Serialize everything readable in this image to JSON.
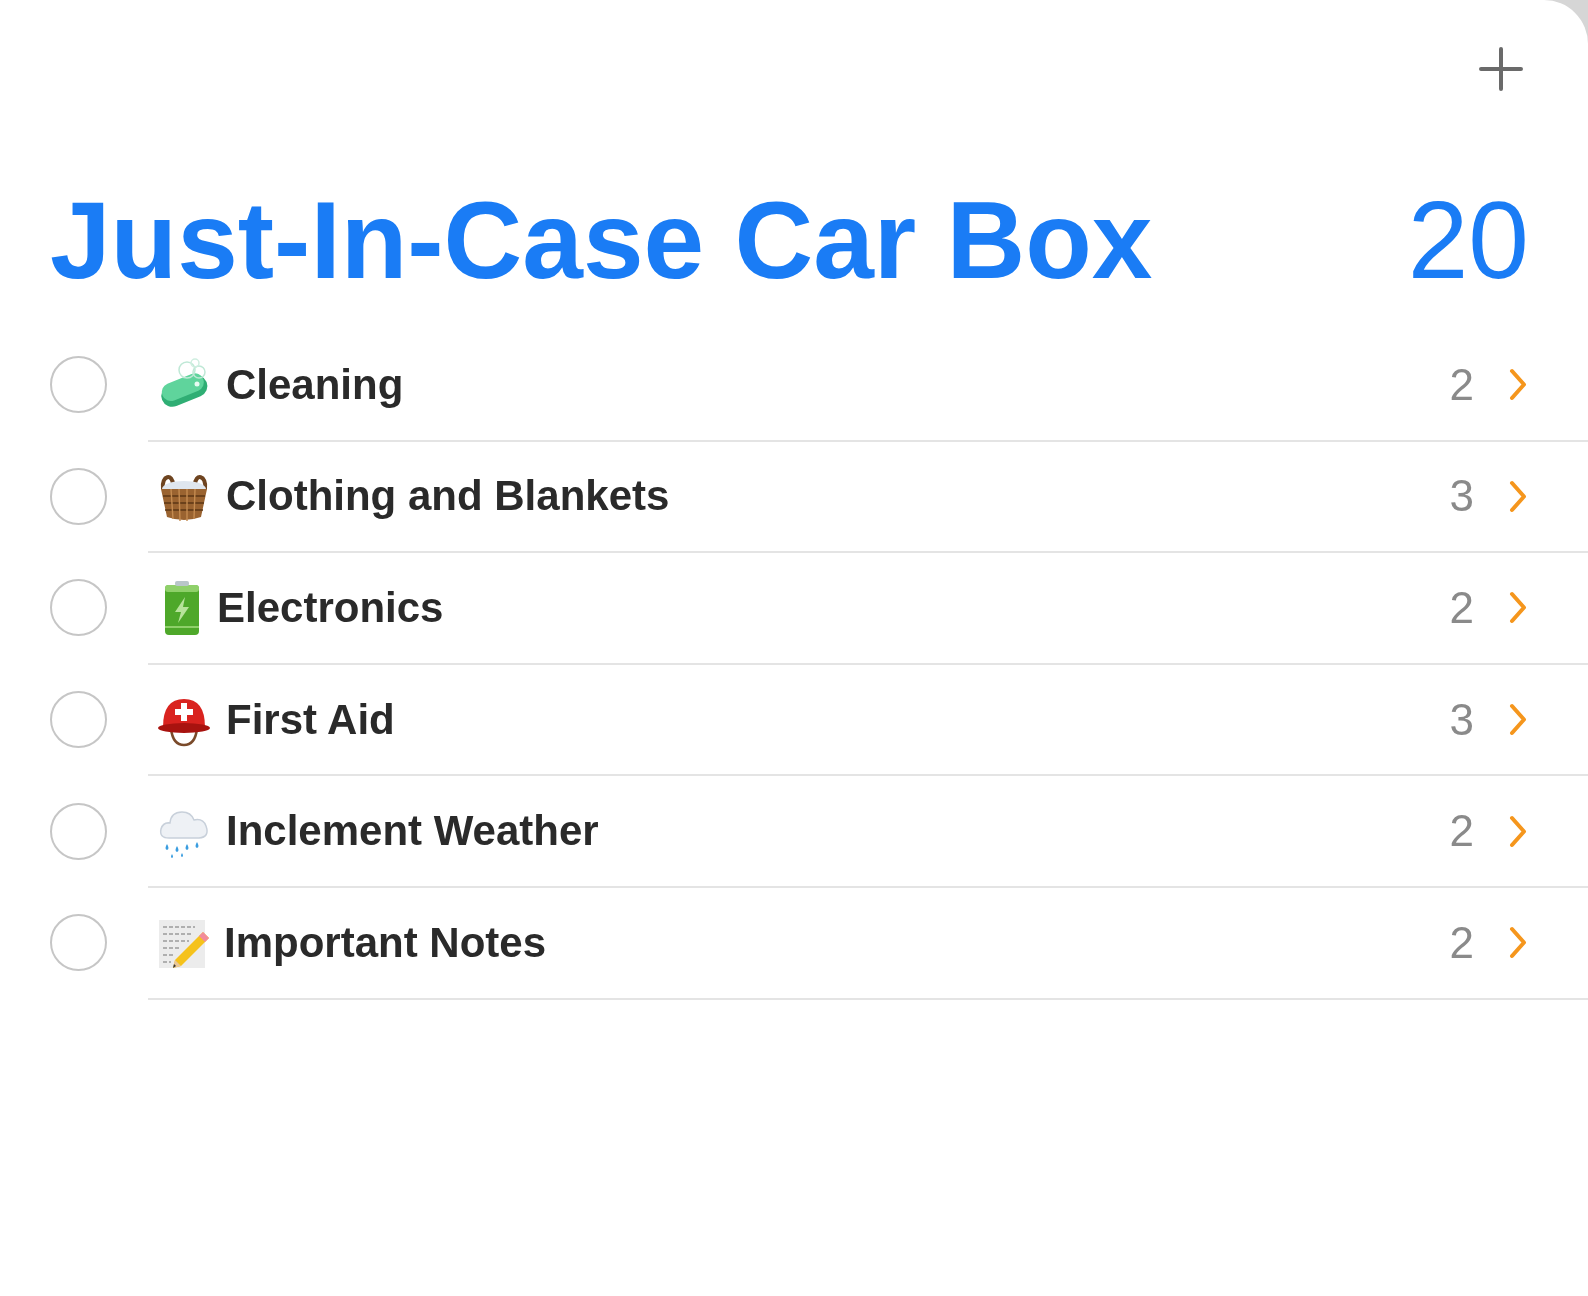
{
  "list": {
    "title": "Just-In-Case Car Box",
    "count": "20"
  },
  "items": [
    {
      "kind": "soap",
      "label": "Cleaning",
      "count": "2",
      "checked": false
    },
    {
      "kind": "basket",
      "label": "Clothing and Blankets",
      "count": "3",
      "checked": false
    },
    {
      "kind": "battery",
      "label": "Electronics",
      "count": "2",
      "checked": false
    },
    {
      "kind": "helmet",
      "label": "First Aid",
      "count": "3",
      "checked": false
    },
    {
      "kind": "rain",
      "label": "Inclement Weather",
      "count": "2",
      "checked": false
    },
    {
      "kind": "memo",
      "label": "Important Notes",
      "count": "2",
      "checked": false
    }
  ]
}
